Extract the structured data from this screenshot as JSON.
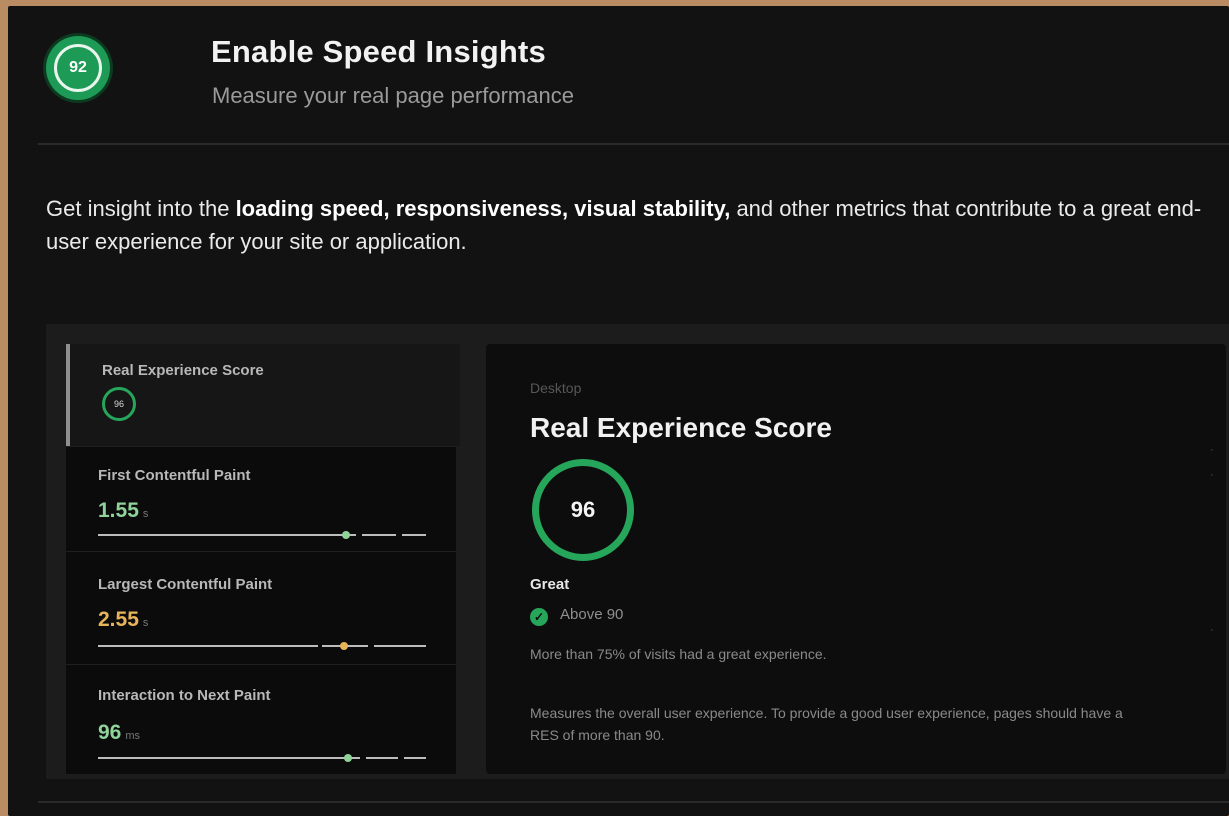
{
  "header": {
    "score": "92",
    "title": "Enable Speed Insights",
    "subtitle": "Measure your real page performance"
  },
  "intro": {
    "prefix": "Get insight into the ",
    "bold": "loading speed, responsiveness, visual stability,",
    "suffix": " and other metrics that contribute to a great end-user experience for your site or application."
  },
  "sidebar": {
    "items": [
      {
        "label": "Real Experience Score",
        "score": "96"
      },
      {
        "label": "First Contentful Paint",
        "value": "1.55",
        "unit": "s",
        "color": "#8fd39a"
      },
      {
        "label": "Largest Contentful Paint",
        "value": "2.55",
        "unit": "s",
        "color": "#e7b45a"
      },
      {
        "label": "Interaction to Next Paint",
        "value": "96",
        "unit": "ms",
        "color": "#8fd39a"
      }
    ]
  },
  "detail": {
    "device": "Desktop",
    "title": "Real Experience Score",
    "score": "96",
    "rating": "Great",
    "threshold": "Above 90",
    "visits": "More than 75% of visits had a great experience.",
    "description": "Measures the overall user experience. To provide a good user experience, pages should have a RES of more than 90."
  },
  "colors": {
    "accent_green": "#26a65b",
    "warning_amber": "#e7b45a",
    "background": "#121212"
  }
}
